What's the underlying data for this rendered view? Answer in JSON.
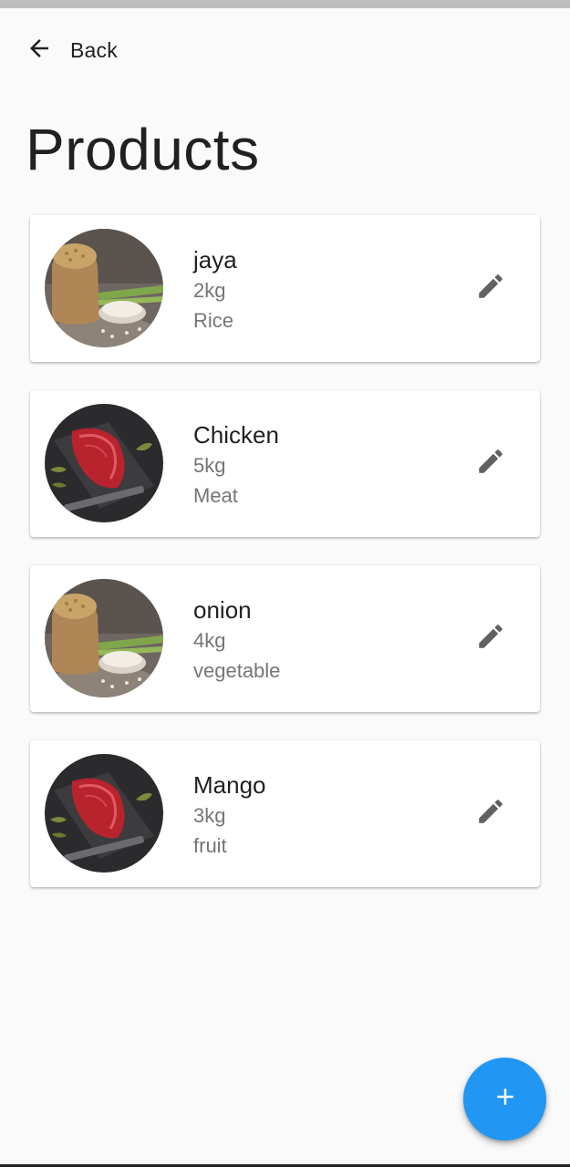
{
  "header": {
    "back_label": "Back",
    "title": "Products"
  },
  "products": [
    {
      "name": "jaya",
      "weight": "2kg",
      "category": "Rice",
      "image": "rice-sack-image"
    },
    {
      "name": "Chicken",
      "weight": "5kg",
      "category": "Meat",
      "image": "raw-meat-image"
    },
    {
      "name": "onion",
      "weight": "4kg",
      "category": "vegetable",
      "image": "rice-sack-image"
    },
    {
      "name": "Mango",
      "weight": "3kg",
      "category": "fruit",
      "image": "raw-meat-image"
    }
  ],
  "icons": {
    "back": "arrow-back-icon",
    "edit": "pencil-icon",
    "add": "plus-icon"
  },
  "colors": {
    "background": "#fafafa",
    "fab": "#2196f3",
    "icon_grey": "#616161",
    "secondary_text": "#757575"
  }
}
